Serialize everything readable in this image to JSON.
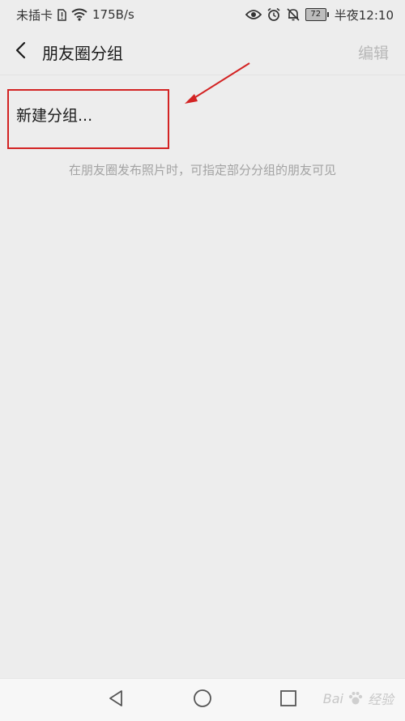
{
  "status_bar": {
    "carrier": "未插卡",
    "speed": "175B/s",
    "battery": "72",
    "time": "半夜12:10",
    "icons": [
      "sim-alert-icon",
      "wifi-icon",
      "eye-icon",
      "alarm-icon",
      "bell-off-icon"
    ]
  },
  "header": {
    "title": "朋友圈分组",
    "edit_label": "编辑",
    "back_icon": "chevron-left-icon"
  },
  "main": {
    "new_group_label": "新建分组...",
    "hint": "在朋友圈发布照片时，可指定部分分组的朋友可见"
  },
  "annotation": {
    "color": "#d32323"
  },
  "navbar": {
    "buttons": [
      "back-triangle-icon",
      "home-circle-icon",
      "recent-square-icon"
    ]
  },
  "watermark": {
    "text": "Bai",
    "text2": "经验"
  }
}
